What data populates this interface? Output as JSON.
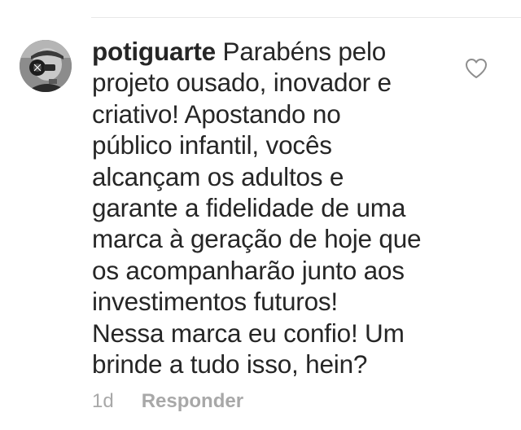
{
  "comment": {
    "username": "potiguarte",
    "text": " Parabéns pelo\nprojeto ousado, inovador e\ncriativo! Apostando no\npúblico infantil, vocês\nalcançam os adultos e\ngarante a fidelidade de uma\nmarca à geração de hoje que\nos acompanharão junto aos\ninvestimentos futuros!\nNessa marca eu confio! Um\nbrinde a tudo isso, hein?",
    "timestamp": "1d",
    "reply_label": "Responder"
  },
  "icons": {
    "like": "heart-outline-icon",
    "avatar": "user-avatar"
  },
  "colors": {
    "text": "#262626",
    "muted": "#a8a8a8",
    "divider": "#e8e8e8",
    "icon": "#8e8e8e"
  }
}
